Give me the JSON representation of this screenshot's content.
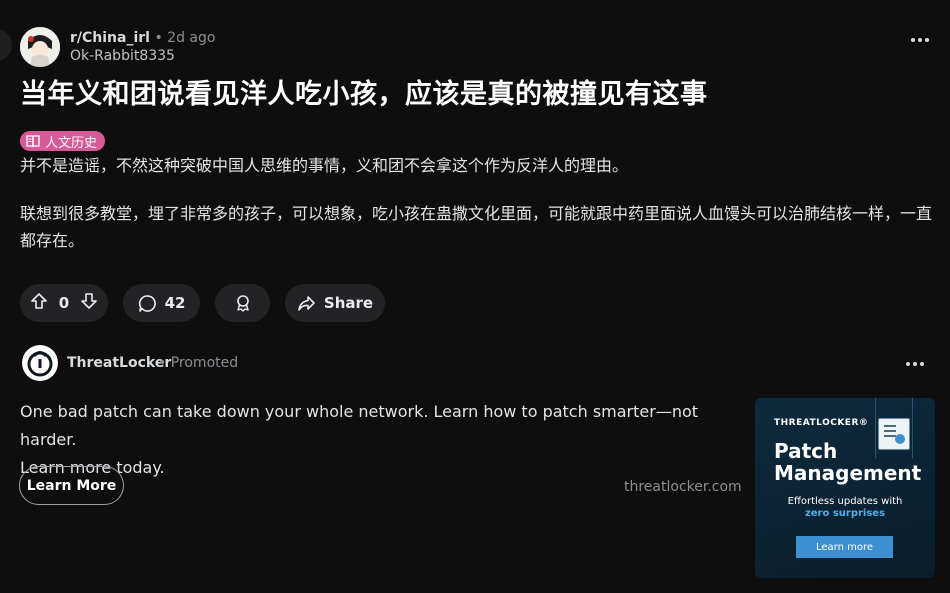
{
  "post": {
    "subreddit": "r/China_irl",
    "separator": "•",
    "age": "2d ago",
    "author": "Ok-Rabbit8335",
    "title": "当年义和团说看见洋人吃小孩，应该是真的被撞见有这事",
    "flair": "人文历史",
    "paragraphs": [
      "并不是造谣，不然这种突破中国人思维的事情，义和团不会拿这个作为反洋人的理由。",
      "联想到很多教堂，埋了非常多的孩子，可以想象，吃小孩在蛊撒文化里面，可能就跟中药里面说人血馒头可以治肺结核一样，一直都存在。"
    ],
    "votes": "0",
    "comments": "42",
    "share_label": "Share"
  },
  "ad": {
    "brand": "ThreatLocker",
    "promoted": "Promoted",
    "separator": "•",
    "text_line1": "One bad patch can take down your whole network. Learn how to patch smarter—not harder.",
    "text_line2": "Learn more today.",
    "cta": "Learn More",
    "domain": "threatlocker.com",
    "card": {
      "brand": "THREATLOCKER®",
      "headline_line1": "Patch",
      "headline_line2": "Management",
      "sub1": "Effortless updates with",
      "sub2": "zero surprises",
      "button": "Learn more"
    }
  },
  "colors": {
    "background": "#0e0e0f",
    "flair": "#d75a98",
    "card_accent": "#4fb0ee",
    "card_button": "#3d8fd0"
  },
  "icons": [
    "upvote-icon",
    "downvote-icon",
    "comment-icon",
    "award-icon",
    "share-icon",
    "more-icon",
    "threatlocker-logo-icon"
  ]
}
